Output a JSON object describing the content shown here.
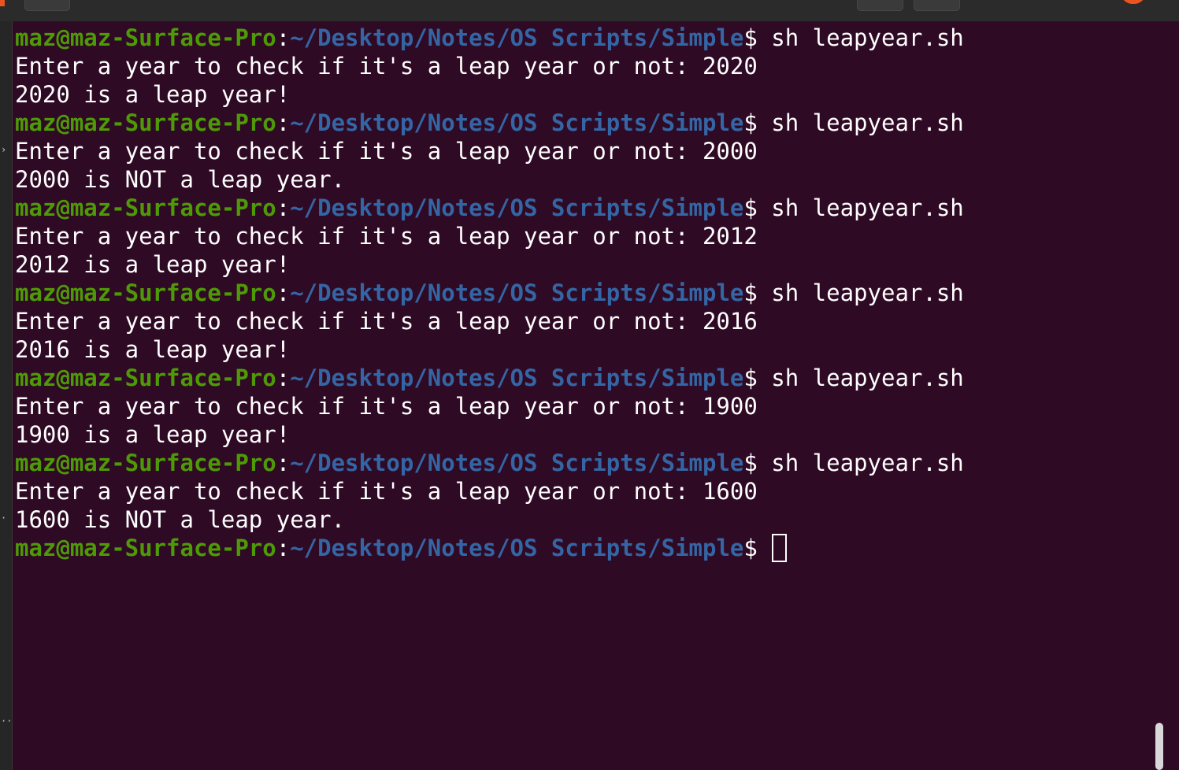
{
  "terminal": {
    "prompt": {
      "user_host": "maz@maz-Surface-Pro",
      "colon": ":",
      "path": "~/Desktop/Notes/OS Scripts/Simple",
      "symbol": "$"
    },
    "sessions": [
      {
        "command": " sh leapyear.sh",
        "input_line": "Enter a year to check if it's a leap year or not: 2020",
        "result_line": "2020 is a leap year!"
      },
      {
        "command": " sh leapyear.sh",
        "input_line": "Enter a year to check if it's a leap year or not: 2000",
        "result_line": "2000 is NOT a leap year."
      },
      {
        "command": " sh leapyear.sh",
        "input_line": "Enter a year to check if it's a leap year or not: 2012",
        "result_line": "2012 is a leap year!"
      },
      {
        "command": " sh leapyear.sh",
        "input_line": "Enter a year to check if it's a leap year or not: 2016",
        "result_line": "2016 is a leap year!"
      },
      {
        "command": " sh leapyear.sh",
        "input_line": "Enter a year to check if it's a leap year or not: 1900",
        "result_line": "1900 is a leap year!"
      },
      {
        "command": " sh leapyear.sh",
        "input_line": "Enter a year to check if it's a leap year or not: 1600",
        "result_line": "1600 is NOT a leap year."
      }
    ],
    "final_prompt_trailing": " "
  },
  "colors": {
    "background": "#2f0a24",
    "user_host": "#4e9a06",
    "path": "#3465a4",
    "text": "#ffffff",
    "accent": "#e95420"
  },
  "icons": {
    "window_accent": "orange-circle-icon",
    "cursor": "block-cursor-icon"
  }
}
